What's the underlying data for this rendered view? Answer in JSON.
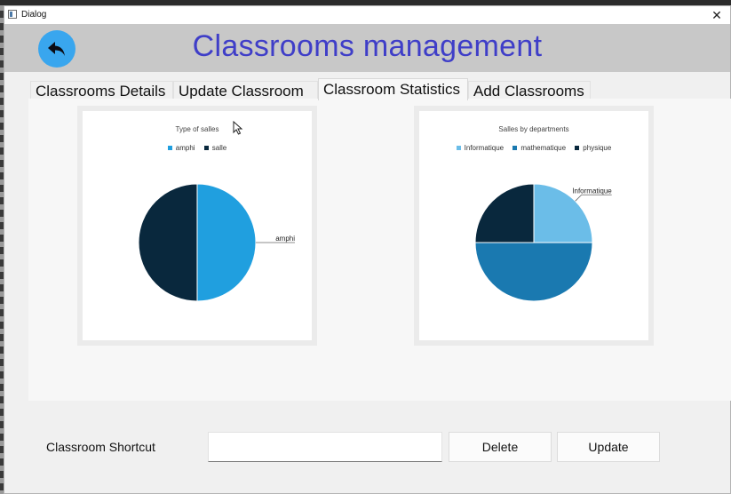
{
  "window": {
    "title": "Dialog",
    "close_glyph": "✕"
  },
  "header": {
    "title": "Classrooms management",
    "back_icon": "back-arrow-icon",
    "accent": "#3f3ec8",
    "back_color": "#39a6ee"
  },
  "tabs": [
    {
      "label": "Classrooms Details",
      "active": false
    },
    {
      "label": "Update Classroom",
      "active": false
    },
    {
      "label": "Classroom Statistics",
      "active": true
    },
    {
      "label": "Add Classrooms",
      "active": false
    }
  ],
  "charts": [
    {
      "title": "Type of salles",
      "legend": [
        {
          "label": "amphi",
          "color": "#209fdf"
        },
        {
          "label": "salle",
          "color": "#09283d"
        }
      ],
      "slice_label": "amphi"
    },
    {
      "title": "Salles by departments",
      "legend": [
        {
          "label": "Informatique",
          "color": "#6bbde8"
        },
        {
          "label": "mathematique",
          "color": "#1a79b0"
        },
        {
          "label": "physique",
          "color": "#09283d"
        }
      ],
      "slice_label": "Informatique"
    }
  ],
  "chart_data": [
    {
      "type": "pie",
      "title": "Type of salles",
      "labels": [
        "amphi",
        "salle"
      ],
      "values": [
        50,
        50
      ],
      "colors": [
        "#209fdf",
        "#09283d"
      ],
      "legend_position": "top"
    },
    {
      "type": "pie",
      "title": "Salles by departments",
      "labels": [
        "Informatique",
        "mathematique",
        "physique"
      ],
      "values": [
        25,
        50,
        25
      ],
      "colors": [
        "#6bbde8",
        "#1a79b0",
        "#09283d"
      ],
      "legend_position": "top"
    }
  ],
  "form": {
    "shortcut_label": "Classroom Shortcut",
    "shortcut_value": "",
    "delete_label": "Delete",
    "update_label": "Update"
  }
}
